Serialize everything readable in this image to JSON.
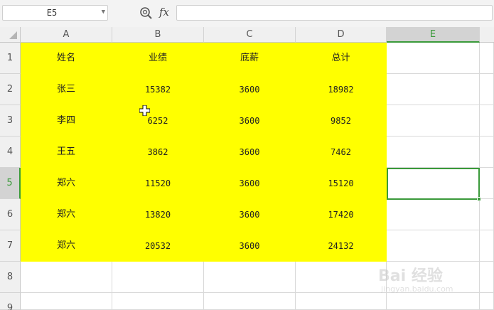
{
  "formula_bar": {
    "name_box": "E5",
    "fx_label": "fx",
    "formula_value": ""
  },
  "columns": [
    "A",
    "B",
    "C",
    "D",
    "E"
  ],
  "active_column": "E",
  "rows": [
    "1",
    "2",
    "3",
    "4",
    "5",
    "6",
    "7",
    "8",
    "9"
  ],
  "active_row": "5",
  "table": {
    "headers": [
      "姓名",
      "业绩",
      "底薪",
      "总计"
    ],
    "records": [
      [
        "张三",
        "15382",
        "3600",
        "18982"
      ],
      [
        "李四",
        "6252",
        "3600",
        "9852"
      ],
      [
        "王五",
        "3862",
        "3600",
        "7462"
      ],
      [
        "郑六",
        "11520",
        "3600",
        "15120"
      ],
      [
        "郑六",
        "13820",
        "3600",
        "17420"
      ],
      [
        "郑六",
        "20532",
        "3600",
        "24132"
      ]
    ]
  },
  "highlight_color": "#ffff00",
  "selection_color": "#3a9a3a",
  "watermark": {
    "text": "Bai 经验",
    "url": "jingyan.baidu.com"
  }
}
